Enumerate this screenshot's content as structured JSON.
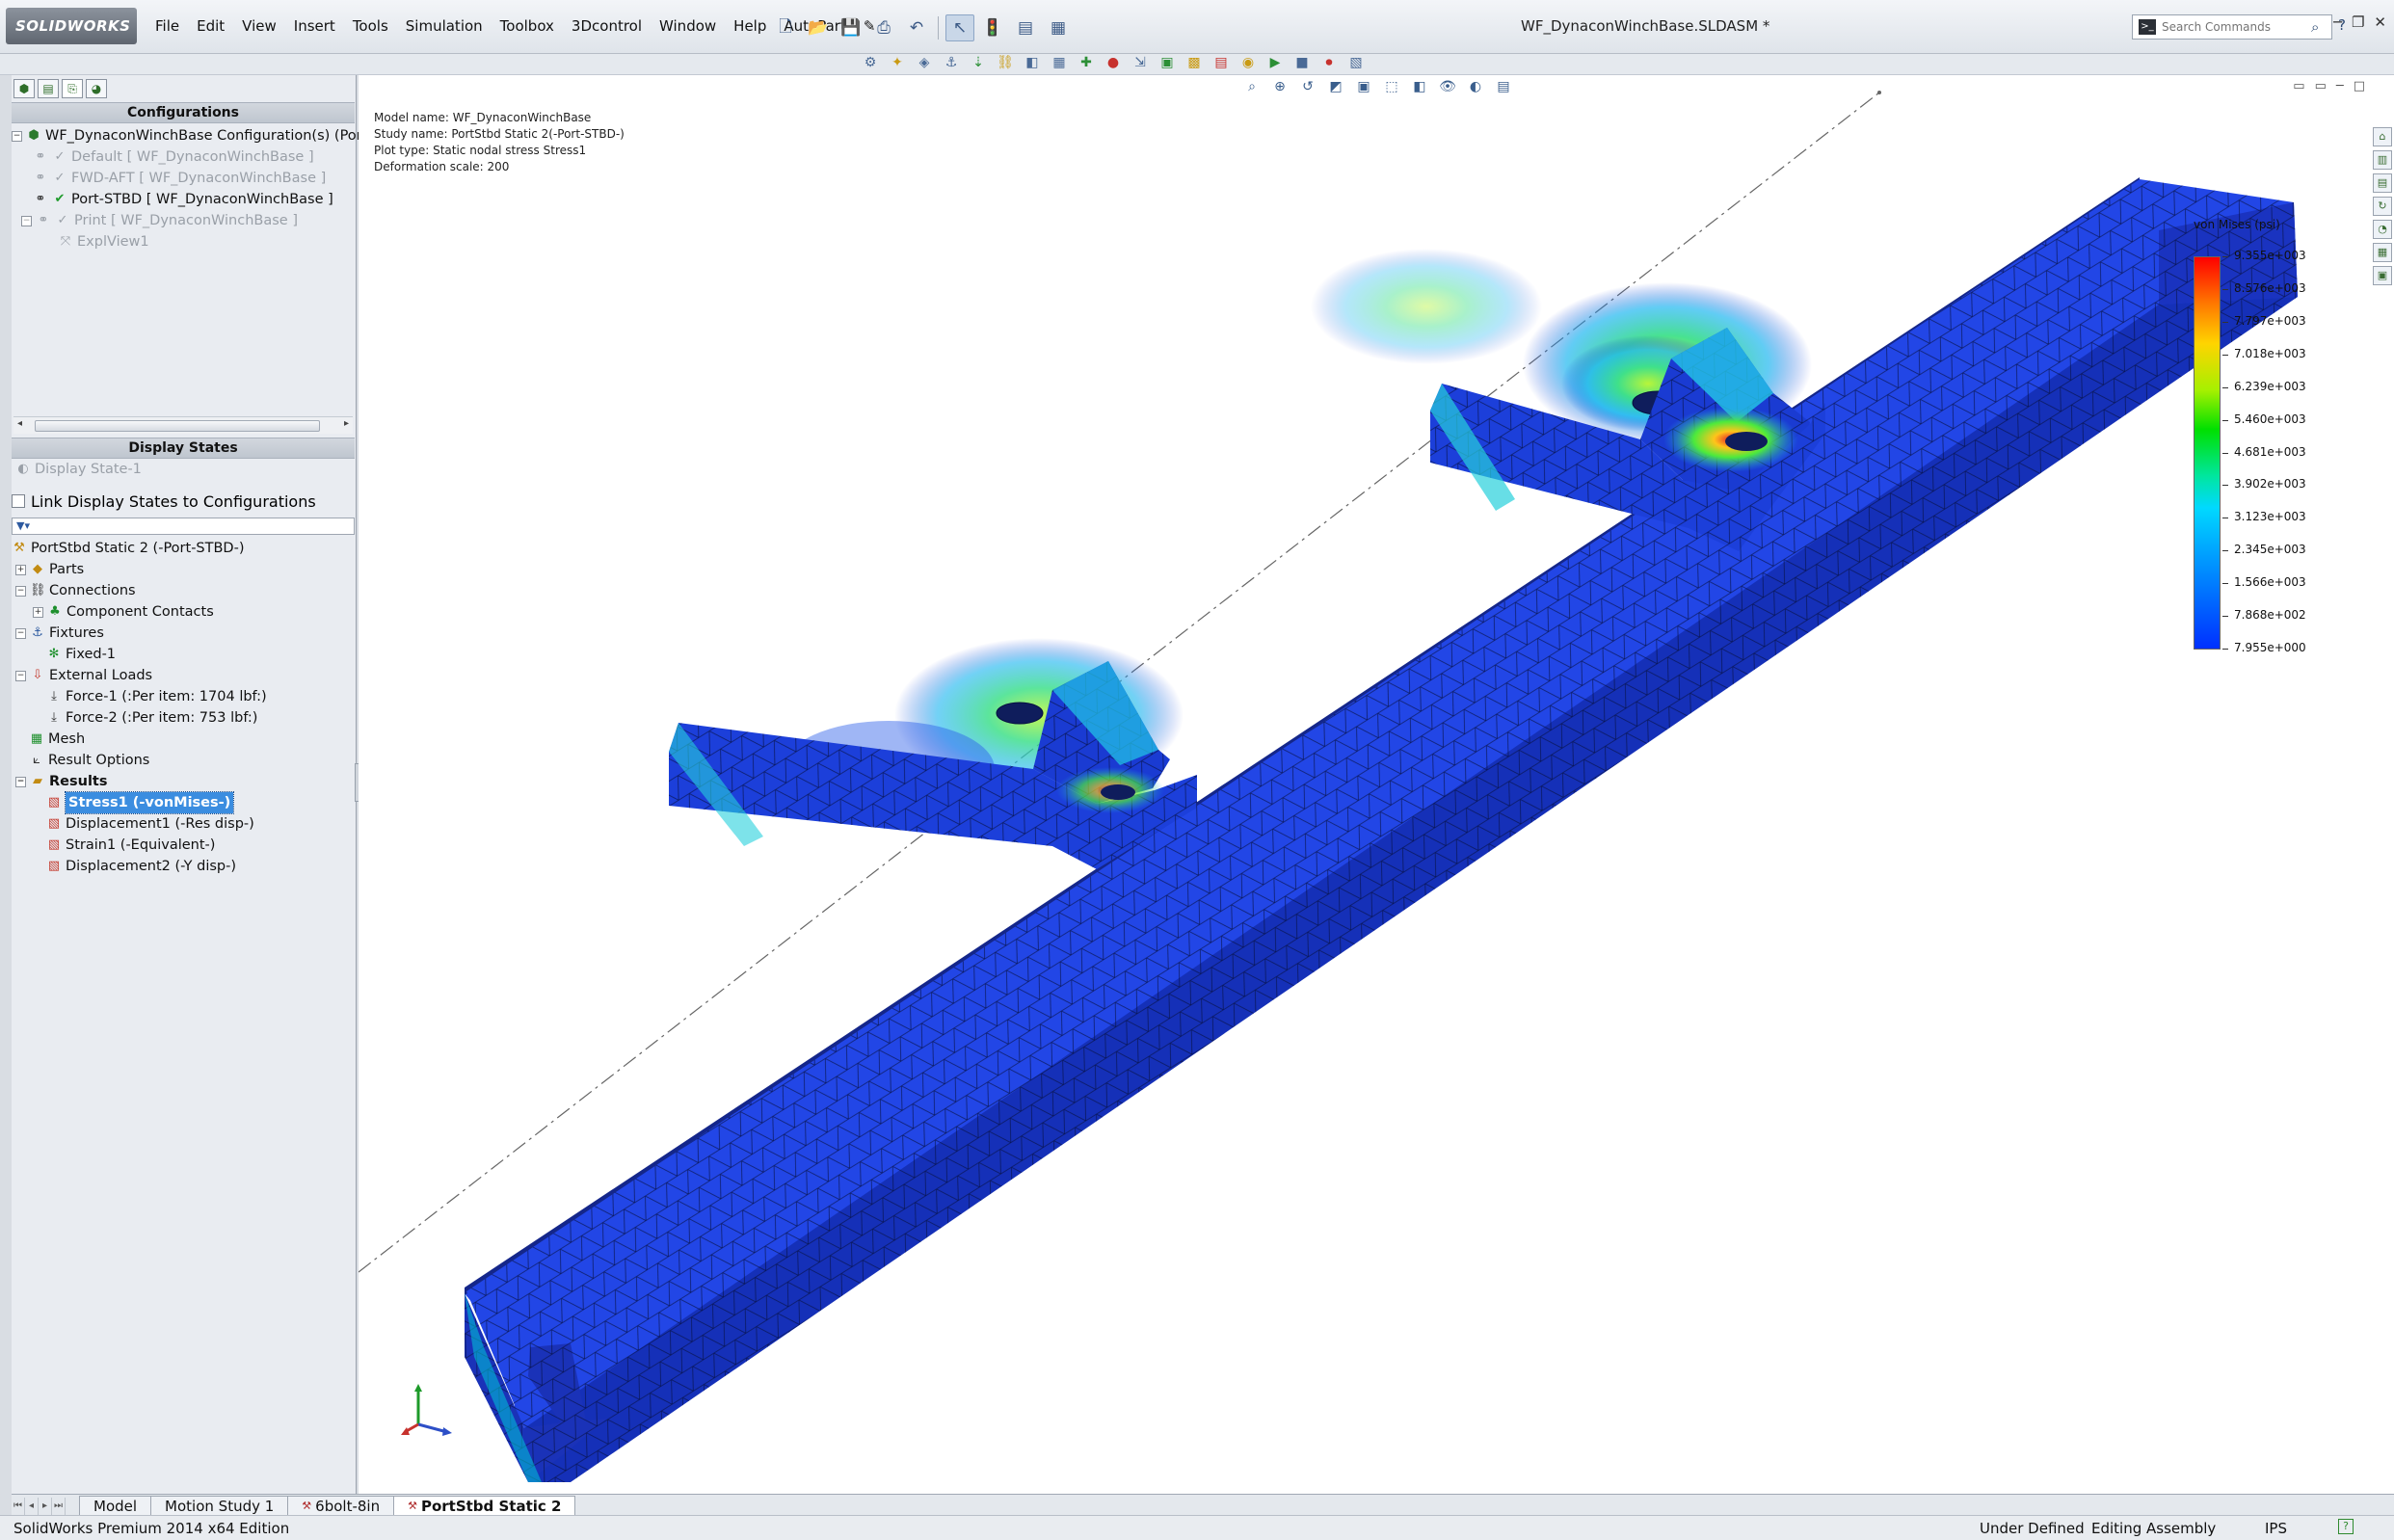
{
  "app": {
    "logo_text": "SOLIDWORKS",
    "document_title": "WF_DynaconWinchBase.SLDASM *"
  },
  "menu": [
    "File",
    "Edit",
    "View",
    "Insert",
    "Tools",
    "Simulation",
    "Toolbox",
    "3Dcontrol",
    "Window",
    "Help",
    "AutoPart"
  ],
  "search": {
    "placeholder": "Search Commands",
    "prompt_icon": "command-prompt-icon"
  },
  "configurations": {
    "header": "Configurations",
    "root": "WF_DynaconWinchBase Configuration(s)  (Port-",
    "items": [
      {
        "label": "Default [ WF_DynaconWinchBase ]",
        "dim": true
      },
      {
        "label": "FWD-AFT [ WF_DynaconWinchBase ]",
        "dim": true
      },
      {
        "label": "Port-STBD [ WF_DynaconWinchBase ]",
        "dim": false
      },
      {
        "label": "Print [ WF_DynaconWinchBase ]",
        "dim": true
      },
      {
        "label": "ExplView1",
        "dim": true
      }
    ]
  },
  "display_states": {
    "header": "Display States",
    "item": "Display State-1",
    "link_label": "Link Display States to Configurations",
    "link_checked": false
  },
  "simulation_tree": {
    "study": "PortStbd Static 2 (-Port-STBD-)",
    "items": {
      "parts": "Parts",
      "connections": "Connections",
      "component_contacts": "Component Contacts",
      "fixtures": "Fixtures",
      "fixed1": "Fixed-1",
      "external_loads": "External Loads",
      "force1": "Force-1 (:Per item: 1704 lbf:)",
      "force2": "Force-2 (:Per item: 753 lbf:)",
      "mesh": "Mesh",
      "result_options": "Result Options",
      "results": "Results",
      "stress1": "Stress1 (-vonMises-)",
      "displacement1": "Displacement1 (-Res disp-)",
      "strain1": "Strain1 (-Equivalent-)",
      "displacement2": "Displacement2 (-Y disp-)"
    }
  },
  "study_info": {
    "model_name": "Model name: WF_DynaconWinchBase",
    "study_name": "Study name: PortStbd Static 2(-Port-STBD-)",
    "plot_type": "Plot type: Static nodal stress Stress1",
    "deformation": "Deformation scale: 200"
  },
  "legend": {
    "title": "von Mises (psi)",
    "labels": [
      "9.355e+003",
      "8.576e+003",
      "7.797e+003",
      "7.018e+003",
      "6.239e+003",
      "5.460e+003",
      "4.681e+003",
      "3.902e+003",
      "3.123e+003",
      "2.345e+003",
      "1.566e+003",
      "7.868e+002",
      "7.955e+000"
    ],
    "colors": {
      "max": "#ff0000",
      "mid": "#00e000",
      "min": "#0030ff"
    }
  },
  "bottom_tabs": [
    {
      "label": "Model",
      "active": false
    },
    {
      "label": "Motion Study 1",
      "active": false
    },
    {
      "label": "6bolt-8in",
      "active": false
    },
    {
      "label": "PortStbd Static 2",
      "active": true
    }
  ],
  "status": {
    "product": "SolidWorks Premium 2014 x64 Edition",
    "definition": "Under Defined",
    "mode": "Editing Assembly",
    "units": "IPS",
    "help": "?"
  },
  "colors": {
    "mesh_blue": "#1a3dd6",
    "mesh_cyan": "#22c4e6",
    "mesh_green": "#46e33a",
    "selection": "#3b8de0"
  }
}
